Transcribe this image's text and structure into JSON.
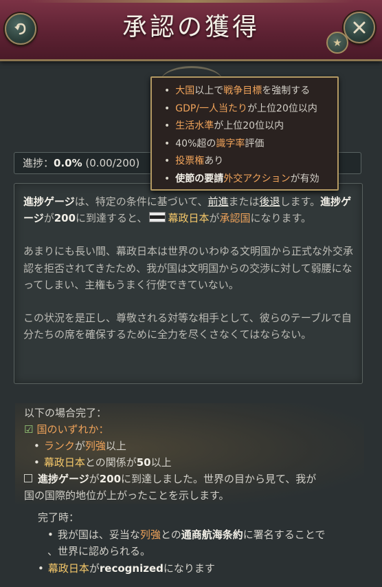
{
  "header": {
    "title": "承認の獲得"
  },
  "progress": {
    "label": "進捗：",
    "percent": "0.0%",
    "detail": "(0.00/200)",
    "value": 0.0
  },
  "tooltip": {
    "items": [
      {
        "parts": [
          {
            "t": "大国",
            "c": "hl"
          },
          {
            "t": "以上で"
          },
          {
            "t": "戦争目標",
            "c": "hl"
          },
          {
            "t": "を強制する"
          }
        ]
      },
      {
        "parts": [
          {
            "t": "GDP/一人当たり",
            "c": "hl"
          },
          {
            "t": "が上位20位以内"
          }
        ]
      },
      {
        "parts": [
          {
            "t": "生活水準",
            "c": "hl"
          },
          {
            "t": "が上位20位以内"
          }
        ]
      },
      {
        "parts": [
          {
            "t": "40%超の"
          },
          {
            "t": "識字率",
            "c": "hl"
          },
          {
            "t": "評価"
          }
        ]
      },
      {
        "parts": [
          {
            "t": "投票権",
            "c": "hl"
          },
          {
            "t": "あり"
          }
        ]
      },
      {
        "parts": [
          {
            "t": "使節の要請",
            "c": "bw"
          },
          {
            "t": "外交アクション",
            "c": "hl"
          },
          {
            "t": "が有効"
          }
        ]
      }
    ]
  },
  "description": {
    "p1_a": "進捗ゲージ",
    "p1_b": "は、特定の条件に基づいて、",
    "p1_c": "前進",
    "p1_d": "または",
    "p1_e": "後退",
    "p1_f": "します。",
    "p1_g": "進捗ゲージ",
    "p1_h": "が",
    "p1_i": "200",
    "p1_j": "に到達すると、",
    "p1_k": "幕政日本",
    "p1_l": "が",
    "p1_m": "承認国",
    "p1_n": "になります。",
    "p2": "あまりにも長い間、幕政日本は世界のいわゆる文明国から正式な外交承認を拒否されてきたため、我が国は文明国からの交渉に対して弱腰になってしまい、主権もうまく行使できていない。",
    "p3": "この状況を是正し、尊敬される対等な相手として、彼らのテーブルで自分たちの席を確保するために全力を尽くさなくてはならない。"
  },
  "conditions": {
    "header": "以下の場合完了：",
    "any_of": "国のいずれか：",
    "rank_a": "ランク",
    "rank_b": "が",
    "rank_c": "列強",
    "rank_d": "以上",
    "rel_a": "幕政日本",
    "rel_b": "との関係が",
    "rel_c": "50",
    "rel_d": "以上",
    "gauge_a": "進捗ゲージ",
    "gauge_b": "が",
    "gauge_c": "200",
    "gauge_d": "に到達しました。世界の目から見て、我が",
    "gauge_e": "国の国際的地位が上がったことを示します。"
  },
  "on_complete": {
    "header": "完了時：",
    "e1_a": "我が国は、妥当な",
    "e1_b": "列強",
    "e1_c": "との",
    "e1_d": "通商航海条約",
    "e1_e": "に署名することで",
    "e1_f": "、世界に認められる。",
    "e2_a": "幕政日本",
    "e2_b": "が",
    "e2_c": "recognized",
    "e2_d": "になります"
  },
  "icons": {
    "back": "undo-arrow-icon",
    "close": "close-x-icon",
    "star": "star-icon",
    "flag": "tokugawa-flag-icon",
    "check": "checkmark-icon",
    "checkbox": "empty-checkbox-icon"
  },
  "colors": {
    "header_bg": "#6a2a3b",
    "accent_gold": "#b49a63",
    "highlight": "#f0a35a",
    "country": "#f5c86a"
  }
}
